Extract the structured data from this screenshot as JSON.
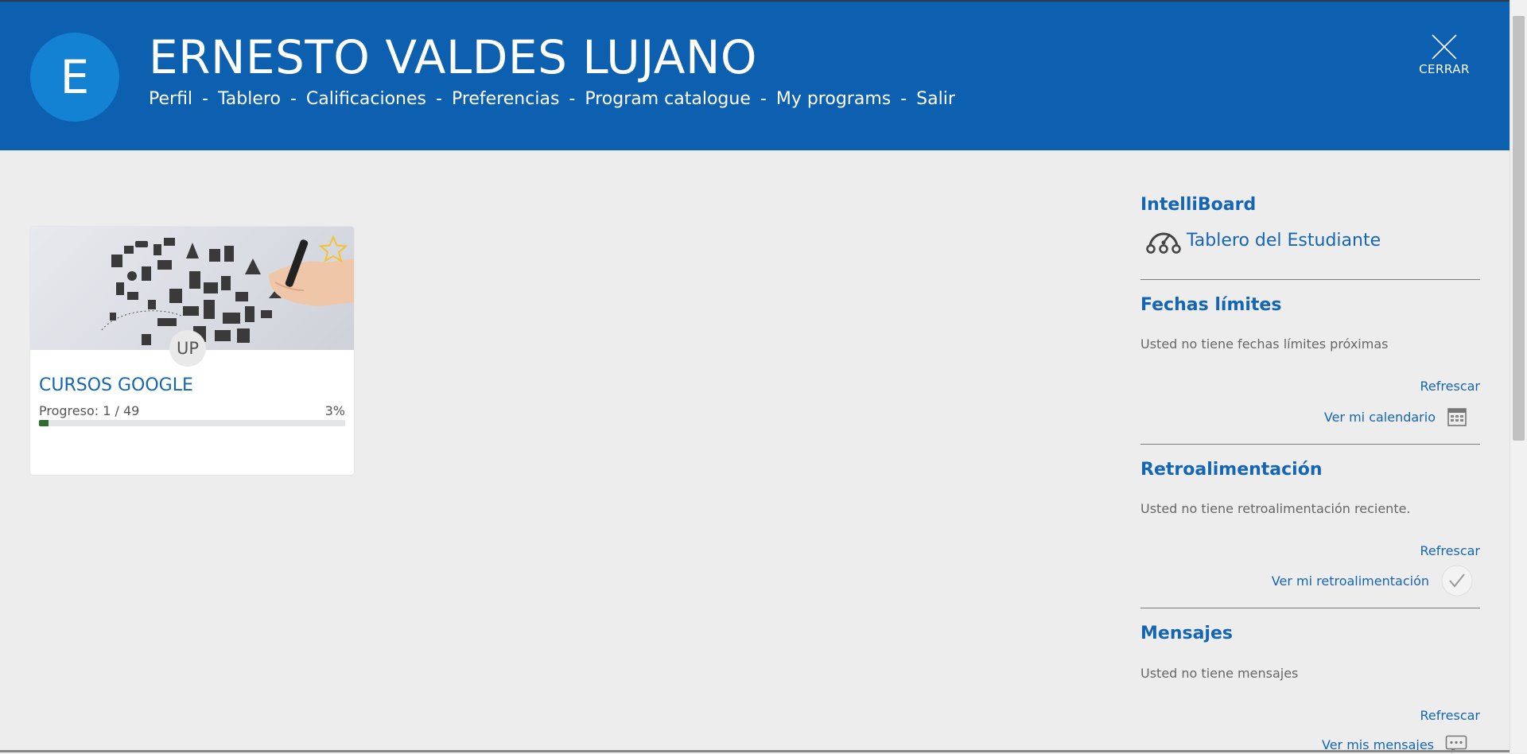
{
  "user": {
    "avatar_initial": "E",
    "name": "ERNESTO VALDES LUJANO"
  },
  "nav": {
    "items": [
      "Perfil",
      "Tablero",
      "Calificaciones",
      "Preferencias",
      "Program catalogue",
      "My programs",
      "Salir"
    ],
    "separator": "-"
  },
  "close": {
    "label": "CERRAR"
  },
  "course": {
    "badge": "UP",
    "title": "CURSOS GOOGLE",
    "progress_text": "Progreso: 1 / 49",
    "progress_percent_text": "3%",
    "progress_fraction": 0.03,
    "progress_color": "#2f6e2f"
  },
  "sidebar": {
    "intelliboard": {
      "title": "IntelliBoard",
      "link": "Tablero del Estudiante"
    },
    "deadlines": {
      "title": "Fechas límites",
      "text": "Usted no tiene fechas límites próximas",
      "refresh": "Refrescar",
      "link": "Ver mi calendario"
    },
    "feedback": {
      "title": "Retroalimentación",
      "text": "Usted no tiene retroalimentación reciente.",
      "refresh": "Refrescar",
      "link": "Ver mi retroalimentación"
    },
    "messages": {
      "title": "Mensajes",
      "text": "Usted no tiene mensajes",
      "refresh": "Refrescar",
      "link": "Ver mis mensajes"
    }
  },
  "colors": {
    "header_bg": "#0d5fb0",
    "avatar_bg": "#1482d2",
    "page_bg": "#ededed",
    "link": "#1565b5",
    "star": "#f2c233"
  }
}
